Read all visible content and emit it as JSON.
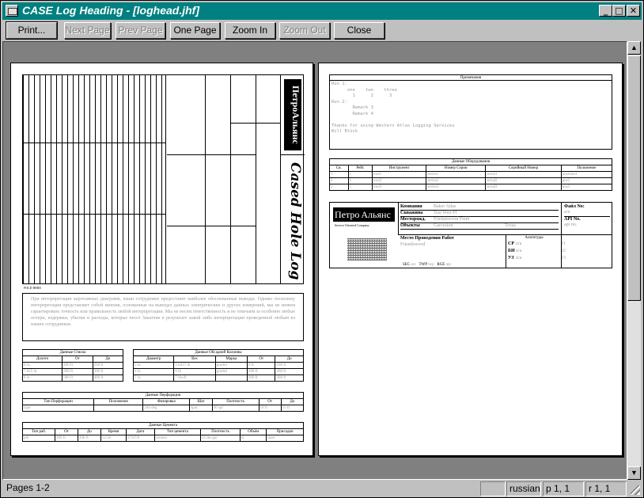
{
  "window": {
    "title": "CASE Log Heading - [loghead.jhf]",
    "controls": {
      "minimize": "_",
      "maximize": "□",
      "close": "✕"
    }
  },
  "toolbar": {
    "print": "Print...",
    "next_page": "Next Page",
    "prev_page": "Prev Page",
    "one_page": "One Page",
    "zoom_in": "Zoom In",
    "zoom_out": "Zoom Out",
    "close": "Close"
  },
  "status": {
    "pages": "Pages 1-2",
    "language": "russian",
    "position_p": "p  1, 1",
    "position_r": "r  1, 1"
  },
  "page2": {
    "remarks_title": "Примечания",
    "remarks_lines": [
      "Run 1:",
      "      one    two    three",
      "        1      2      3",
      "Run 2:",
      "        Remark 3",
      "        Remark 4",
      "",
      "Thanks for using Western Atlas Logging Services",
      "Bill Block"
    ],
    "equipment_title": "Данные Оборудования",
    "equipment_headers": [
      "Св.",
      "Рейс",
      "Инструмент",
      "Номер Серии",
      "Серийный Номер",
      "Положение"
    ],
    "equipment_rows": [
      [
        "1",
        "1",
        "tool1",
        "series1",
        "serial1",
        "position1"
      ],
      [
        "2",
        "1",
        "tool2",
        "series2",
        "serial2",
        "pos2"
      ],
      [
        "3",
        "1",
        "tool3",
        "series3",
        "serial3",
        "pos3"
      ]
    ],
    "company_label": "Компания",
    "company_value": "Baker Atlas",
    "well_label": "Скважина",
    "well_value": "Test Well #1",
    "field_label": "Месторожд.",
    "field_value": "Friendswood Field",
    "object_label": "Объекты",
    "object_value": "Galveston",
    "object_value2": "Texas",
    "location_label": "Место Проведения Работ",
    "location_value": "Friendswood",
    "fold_label": "Файл No:",
    "fold_value": "a/n",
    "api_label": "API No.",
    "api_value": "api no.",
    "altitude_title": "Альтитуды",
    "alt_rows": [
      [
        "СР",
        "n/a",
        "r1"
      ],
      [
        "БИ",
        "n/a",
        "r2"
      ],
      [
        "УЗ",
        "n/a",
        "r3"
      ]
    ],
    "sec_label": "SEC",
    "sec_value": "sec",
    "twp_label": "TWP",
    "twp_value": "twp",
    "rge_label": "RGE",
    "rge_value": "rge",
    "logo_main": "Петро",
    "logo_sub": "Альянс",
    "logo_tag": "Service Oriented Company"
  },
  "page1": {
    "disclaimer": "При интерпретации каротажных диаграмм, наши сотрудники предоставят наиболее обоснованные выводы. Однако поскольку интерпретация представляет собой мнения, основанные на выводах данных электрических и других измерений, мы не можем гарантировать точность или правильность любой интерпретации. Мы не несем ответственность и не отвечаем за особенно любые потери, издержки, убытки и расходы, которые несет Заказчик в результате какой либо интерпретации проведенной любым из наших сотрудников.",
    "casing_title": "Данные Ствола",
    "casing_headers": [
      "Долото",
      "От",
      "До"
    ],
    "casing_rows": [
      [
        "6 in.",
        "100 ft",
        "200 ft"
      ],
      [
        "7.625 in",
        "200 ft",
        "300 ft"
      ],
      [
        "8 in",
        "300 ft",
        "400 ft"
      ]
    ],
    "tubing_title": "Данные Обсадной Колонны",
    "tubing_headers": [
      "Диаметр",
      "Вес",
      "Марка",
      "От",
      "До"
    ],
    "tubing_rows": [
      [
        "5 in",
        "5.6437 lb",
        "grade1",
        "0 ft",
        "100 ft"
      ],
      [
        "6 in",
        "6 lb",
        "grade2",
        "100 ft",
        "200 ft"
      ],
      [
        "7 in",
        "7 lbs/ft",
        "",
        "200 ft",
        "300 ft"
      ]
    ],
    "perf_title": "Данные Перфорации",
    "perf_headers": [
      "Тип Перфорации",
      "Положение",
      "Фазировка",
      "Шаг",
      "Плотность",
      "От",
      "До"
    ],
    "perf_rows": [
      [
        "type",
        "",
        "240 deg",
        "spac",
        "40 spf",
        "10 ft",
        "15 ft"
      ]
    ],
    "cement_title": "Данные Цемента",
    "cement_headers": [
      "Тип раб.",
      "От",
      "До",
      "Время",
      "Дата",
      "Тип цемента",
      "Плотность",
      "Объём",
      "Присадки"
    ],
    "cement_rows": [
      [
        "job",
        "100 ft",
        "200 ft",
        "12:30",
        "17/07/9",
        "cement",
        "25 lbs/gal",
        "sl",
        "liner"
      ]
    ],
    "logo_main": "Петро",
    "logo_sub": "Альянс",
    "script_title": "Cased Hole Log",
    "fold_here": "FOLD HERE"
  },
  "colors": {
    "titlebar": "#008080",
    "chrome": "#c0c0c0",
    "viewport": "#808080"
  }
}
